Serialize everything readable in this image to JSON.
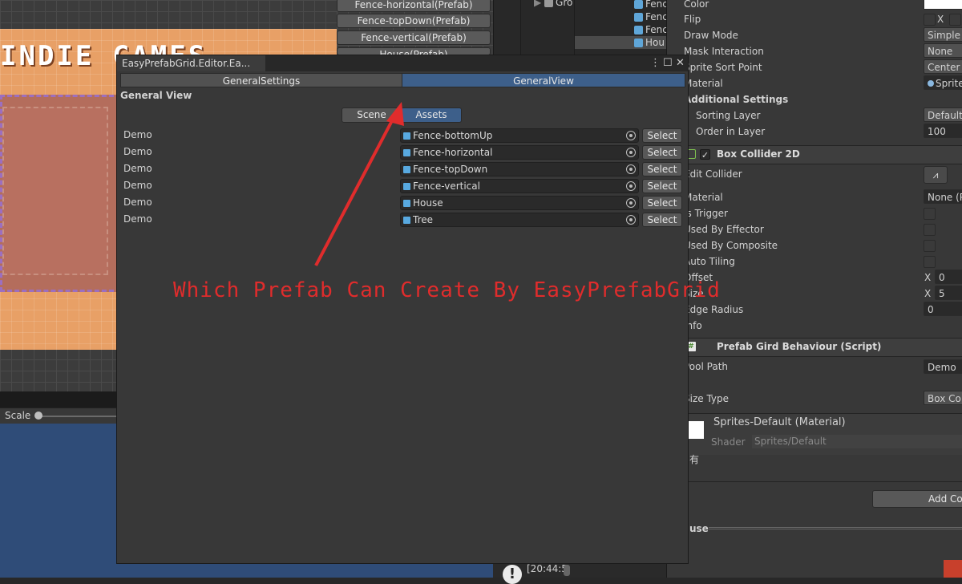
{
  "scene": {
    "logo_text": "INDIE GAMES",
    "buttons": [
      "Fence-horizontal(Prefab)",
      "Fence-topDown(Prefab)",
      "Fence-vertical(Prefab)",
      "House(Prefab)"
    ],
    "scale_label": "Scale"
  },
  "hierarchy": {
    "items": [
      "Gro",
      "Fenc",
      "Fenc",
      "Fenc",
      "Hou"
    ]
  },
  "console": {
    "timestamp": "[20:44:5"
  },
  "inspector": {
    "sprite_renderer": {
      "color_label": "Color",
      "flip_label": "Flip",
      "flip_x": "X",
      "draw_mode_label": "Draw Mode",
      "draw_mode_value": "Simple",
      "mask_interaction_label": "Mask Interaction",
      "mask_interaction_value": "None",
      "sprite_sort_point_label": "Sprite Sort Point",
      "sprite_sort_point_value": "Center",
      "material_label": "Material",
      "material_value": "Sprite",
      "additional_settings_label": "Additional Settings",
      "sorting_layer_label": "Sorting Layer",
      "sorting_layer_value": "Default",
      "order_in_layer_label": "Order in Layer",
      "order_in_layer_value": "100"
    },
    "box_collider": {
      "header": "Box Collider 2D",
      "edit_collider_label": "Edit Collider",
      "material_label": "Material",
      "material_value": "None (P",
      "is_trigger_label": "Is Trigger",
      "used_by_effector_label": "Used By Effector",
      "used_by_composite_label": "Used By Composite",
      "auto_tiling_label": "Auto Tiling",
      "offset_label": "Offset",
      "offset_x_label": "X",
      "offset_x_value": "0",
      "size_label": "Size",
      "size_x_label": "X",
      "size_x_value": "5",
      "edge_radius_label": "Edge Radius",
      "edge_radius_value": "0",
      "info_label": "Info"
    },
    "prefab_behaviour": {
      "header": "Prefab Gird Behaviour (Script)",
      "pool_path_label": "Pool Path",
      "pool_path_value": "Demo",
      "size_type_label": "Size Type",
      "size_type_value": "Box Coll"
    },
    "material": {
      "name": "Sprites-Default (Material)",
      "shader_label": "Shader",
      "shader_value": "Sprites/Default",
      "extra_text": "有"
    },
    "add_component_label": "Add Com",
    "house_label": "use"
  },
  "editor": {
    "title": "EasyPrefabGrid.Editor.Ea...",
    "tabs": [
      "GeneralSettings",
      "GeneralView"
    ],
    "active_tab": "GeneralView",
    "section_title": "General View",
    "sub_tabs": [
      "Scene",
      "Assets"
    ],
    "active_sub_tab": "Assets",
    "rows": [
      {
        "label": "Demo",
        "asset": "Fence-bottomUp",
        "button": "Select"
      },
      {
        "label": "Demo",
        "asset": "Fence-horizontal",
        "button": "Select"
      },
      {
        "label": "Demo",
        "asset": "Fence-topDown",
        "button": "Select"
      },
      {
        "label": "Demo",
        "asset": "Fence-vertical",
        "button": "Select"
      },
      {
        "label": "Demo",
        "asset": "House",
        "button": "Select"
      },
      {
        "label": "Demo",
        "asset": "Tree",
        "button": "Select"
      }
    ],
    "annotation": "Which Prefab Can Create By EasyPrefabGrid"
  },
  "colors": {
    "accent_tab": "#3d5f8a",
    "annotation": "#e02c2c",
    "scene_orange": "#e8a066",
    "game_blue": "#2f4c78"
  }
}
